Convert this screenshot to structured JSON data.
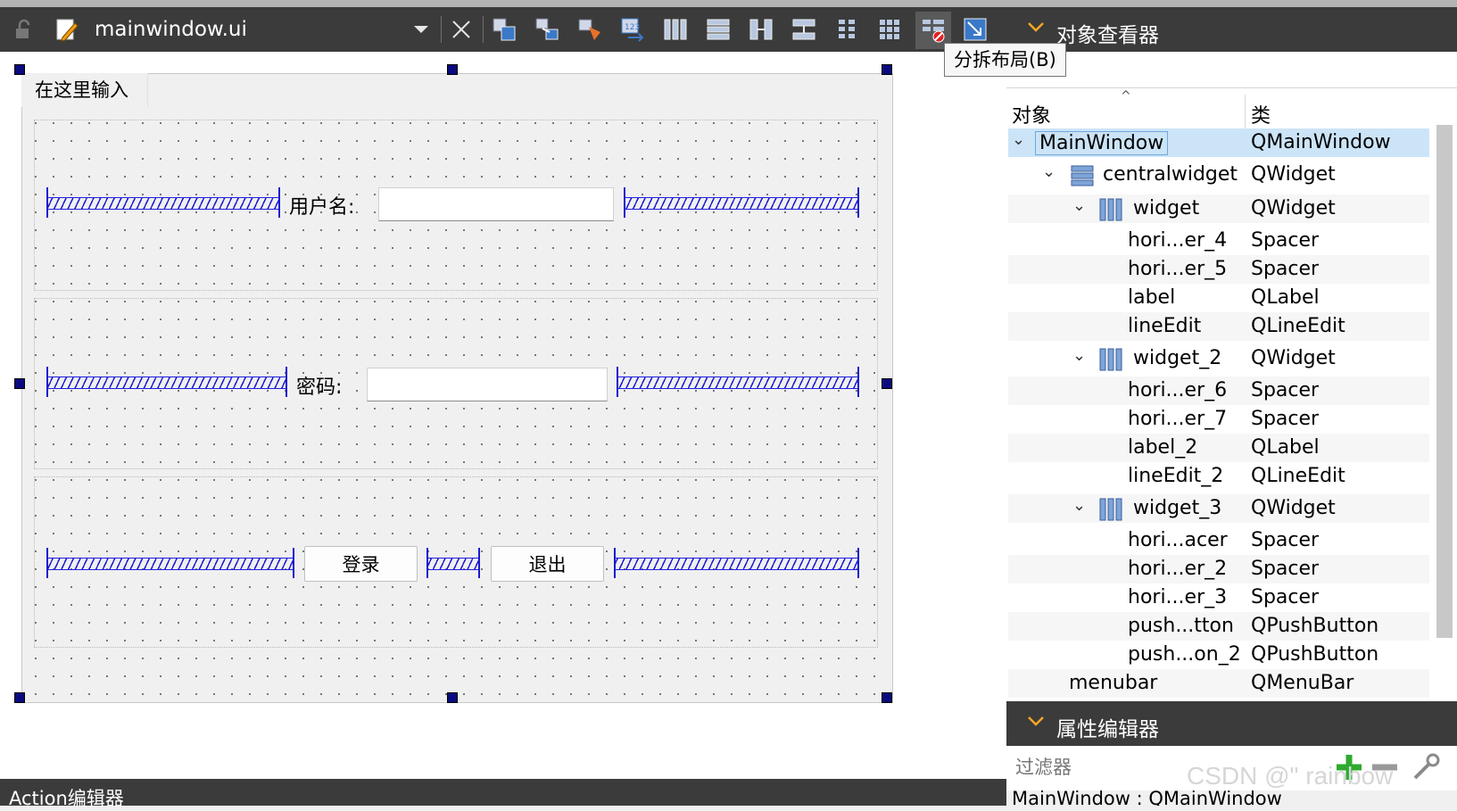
{
  "toolbar": {
    "file_name": "mainwindow.ui",
    "tooltip": "分拆布局(B)",
    "icons": [
      "lock-icon",
      "edit-file-icon",
      "dropdown-arrow-icon",
      "close-icon",
      "edit-widgets-icon",
      "edit-signals-slots-icon",
      "edit-buddies-icon",
      "edit-tab-order-icon",
      "layout-horizontal-icon",
      "layout-vertical-icon",
      "splitter-horizontal-icon",
      "splitter-vertical-icon",
      "layout-form-icon",
      "layout-grid-icon",
      "break-layout-icon",
      "adjust-size-icon"
    ]
  },
  "form": {
    "menu_title": "在这里输入",
    "username_label": "用户名:",
    "password_label": "密码:",
    "login_button": "登录",
    "exit_button": "退出"
  },
  "action_editor": {
    "title": "Action编辑器"
  },
  "object_inspector": {
    "title": "对象查看器",
    "col_object": "对象",
    "col_class": "类",
    "rows": [
      {
        "name": "MainWindow",
        "class": "QMainWindow"
      },
      {
        "name": "centralwidget",
        "class": "QWidget"
      },
      {
        "name": "widget",
        "class": "QWidget"
      },
      {
        "name": "hori...er_4",
        "class": "Spacer"
      },
      {
        "name": "hori...er_5",
        "class": "Spacer"
      },
      {
        "name": "label",
        "class": "QLabel"
      },
      {
        "name": "lineEdit",
        "class": "QLineEdit"
      },
      {
        "name": "widget_2",
        "class": "QWidget"
      },
      {
        "name": "hori...er_6",
        "class": "Spacer"
      },
      {
        "name": "hori...er_7",
        "class": "Spacer"
      },
      {
        "name": "label_2",
        "class": "QLabel"
      },
      {
        "name": "lineEdit_2",
        "class": "QLineEdit"
      },
      {
        "name": "widget_3",
        "class": "QWidget"
      },
      {
        "name": "hori...acer",
        "class": "Spacer"
      },
      {
        "name": "hori...er_2",
        "class": "Spacer"
      },
      {
        "name": "hori...er_3",
        "class": "Spacer"
      },
      {
        "name": "push...tton",
        "class": "QPushButton"
      },
      {
        "name": "push...on_2",
        "class": "QPushButton"
      },
      {
        "name": "menubar",
        "class": "QMenuBar"
      }
    ]
  },
  "property_editor": {
    "title": "属性编辑器",
    "filter_placeholder": "过滤器",
    "status": "MainWindow : QMainWindow"
  },
  "watermark": "CSDN @\" rainbow"
}
